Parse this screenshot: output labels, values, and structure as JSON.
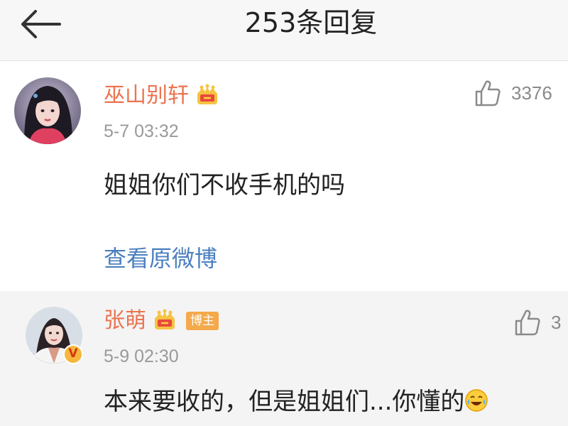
{
  "header": {
    "title": "253条回复",
    "back_icon": "back-arrow-icon"
  },
  "comments": [
    {
      "username": "巫山别轩",
      "time": "5-7 03:32",
      "text": "姐姐你们不收手机的吗",
      "likes": "3376",
      "view_original": "查看原微博",
      "badge": "crown-icon",
      "name_color": "#eb7350"
    },
    {
      "username": "张萌",
      "host_badge": "博主",
      "time": "5-9 02:30",
      "text": "本来要收的，但是姐姐们...你懂的",
      "likes": "3",
      "verified": "V",
      "emoji": "laugh-cry-emoji",
      "badge": "crown-icon"
    }
  ],
  "colors": {
    "accent_name": "#eb7350",
    "link": "#4b7fbf",
    "muted": "#999999",
    "host_badge": "#f4a94a",
    "header_bg": "#f7f7f7"
  }
}
